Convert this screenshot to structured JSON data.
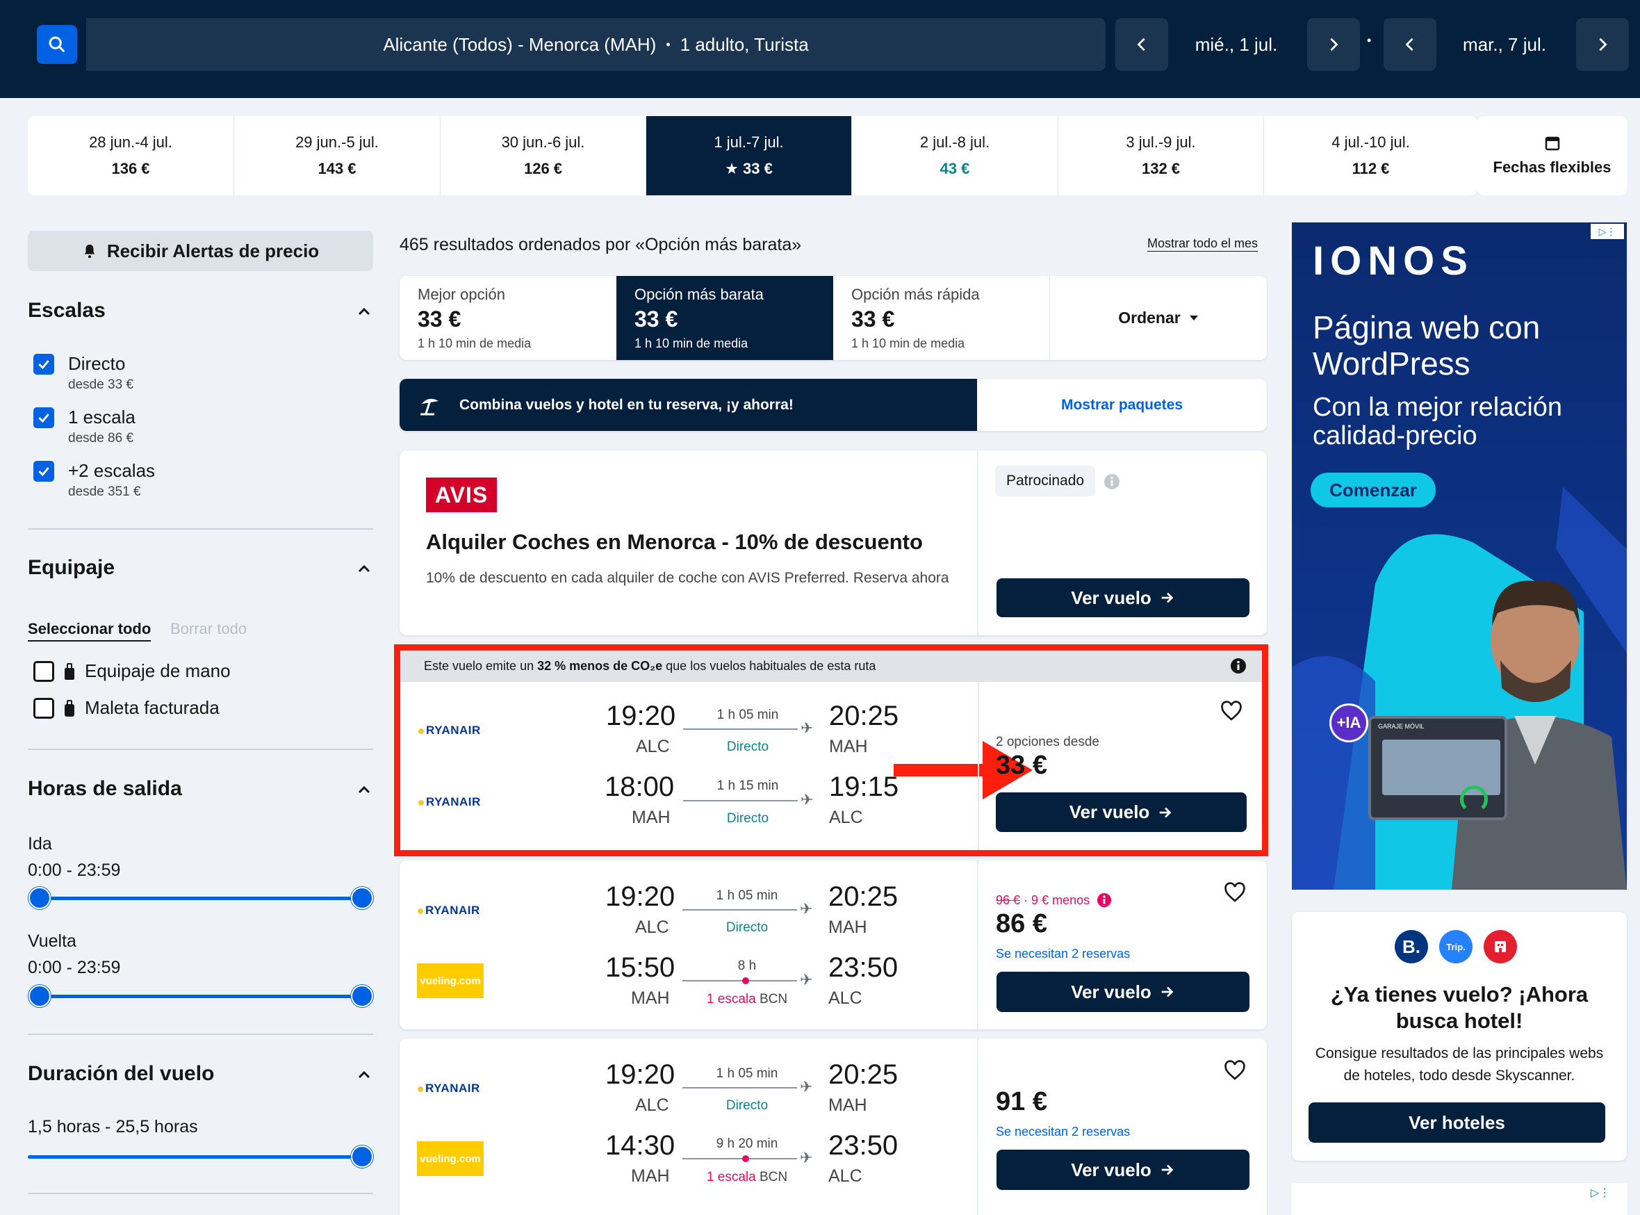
{
  "header": {
    "route": "Alicante (Todos) - Menorca (MAH)",
    "separator": "•",
    "passengers": "1 adulto, Turista",
    "depart_date": "mié., 1 jul.",
    "return_date": "mar., 7 jul.",
    "date_separator": "•"
  },
  "date_strip": [
    {
      "dates": "28 jun.-4 jul.",
      "price": "136 €"
    },
    {
      "dates": "29 jun.-5 jul.",
      "price": "143 €"
    },
    {
      "dates": "30 jun.-6 jul.",
      "price": "126 €"
    },
    {
      "dates": "1 jul.-7 jul.",
      "price": "★ 33 €"
    },
    {
      "dates": "2 jul.-8 jul.",
      "price": "43 €"
    },
    {
      "dates": "3 jul.-9 jul.",
      "price": "132 €"
    },
    {
      "dates": "4 jul.-10 jul.",
      "price": "112 €"
    }
  ],
  "flexible_dates_label": "Fechas flexibles",
  "sidebar": {
    "price_alert": "Recibir Alertas de precio",
    "stops": {
      "title": "Escalas",
      "items": [
        {
          "label": "Directo",
          "sub": "desde 33 €"
        },
        {
          "label": "1 escala",
          "sub": "desde 86 €"
        },
        {
          "label": "+2 escalas",
          "sub": "desde 351 €"
        }
      ]
    },
    "baggage": {
      "title": "Equipaje",
      "select_all": "Seleccionar todo",
      "clear_all": "Borrar todo",
      "items": [
        {
          "label": "Equipaje de mano"
        },
        {
          "label": "Maleta facturada"
        }
      ]
    },
    "departure_times": {
      "title": "Horas de salida",
      "outbound_label": "Ida",
      "outbound_range": "0:00 - 23:59",
      "return_label": "Vuelta",
      "return_range": "0:00 - 23:59"
    },
    "duration": {
      "title": "Duración del vuelo",
      "range": "1,5 horas - 25,5 horas"
    }
  },
  "results": {
    "summary": "465 resultados ordenados por «Opción más barata»",
    "show_month": "Mostrar todo el mes",
    "sort_tabs": [
      {
        "label": "Mejor opción",
        "price": "33 €",
        "sub": "1 h 10 min de media"
      },
      {
        "label": "Opción más barata",
        "price": "33 €",
        "sub": "1 h 10 min de media"
      },
      {
        "label": "Opción más rápida",
        "price": "33 €",
        "sub": "1 h 10 min de media"
      }
    ],
    "sort_button": "Ordenar",
    "package_banner": "Combina vuelos y hotel en tu reserva, ¡y ahorra!",
    "package_button": "Mostrar paquetes"
  },
  "ad_card": {
    "logo": "AVIS",
    "title": "Alquiler Coches en Menorca - 10% de descuento",
    "body": "10% de descuento en cada alquiler de coche con AVIS Preferred. Reserva ahora",
    "sponsored": "Patrocinado",
    "button": "Ver vuelo"
  },
  "eco_banner": {
    "pre": "Este vuelo emite un ",
    "bold": "32 % menos de CO₂e",
    "post": " que los vuelos habituales de esta ruta"
  },
  "flights": [
    {
      "legs": [
        {
          "airline": "RYANAIR",
          "dep": "19:20",
          "dep_code": "ALC",
          "dur": "1 h 05 min",
          "stops": "Directo",
          "arr": "20:25",
          "arr_code": "MAH"
        },
        {
          "airline": "RYANAIR",
          "dep": "18:00",
          "dep_code": "MAH",
          "dur": "1 h 15 min",
          "stops": "Directo",
          "arr": "19:15",
          "arr_code": "ALC"
        }
      ],
      "options": "2 opciones desde",
      "price": "33 €",
      "button": "Ver vuelo"
    },
    {
      "legs": [
        {
          "airline": "RYANAIR",
          "dep": "19:20",
          "dep_code": "ALC",
          "dur": "1 h 05 min",
          "stops": "Directo",
          "arr": "20:25",
          "arr_code": "MAH"
        },
        {
          "airline": "vueling.com",
          "dep": "15:50",
          "dep_code": "MAH",
          "dur": "8 h",
          "stops": "1 escala",
          "stop_code": "BCN",
          "arr": "23:50",
          "arr_code": "ALC"
        }
      ],
      "old_price": "96 €",
      "saving": " · 9 € menos",
      "price": "86 €",
      "note": "Se necesitan 2 reservas",
      "button": "Ver vuelo"
    },
    {
      "legs": [
        {
          "airline": "RYANAIR",
          "dep": "19:20",
          "dep_code": "ALC",
          "dur": "1 h 05 min",
          "stops": "Directo",
          "arr": "20:25",
          "arr_code": "MAH"
        },
        {
          "airline": "vueling.com",
          "dep": "14:30",
          "dep_code": "MAH",
          "dur": "9 h 20 min",
          "stops": "1 escala",
          "stop_code": "BCN",
          "arr": "23:50",
          "arr_code": "ALC"
        }
      ],
      "price": "91 €",
      "note": "Se necesitan 2 reservas",
      "button": "Ver vuelo"
    }
  ],
  "side_ad": {
    "brand": "IONOS",
    "headline": "Página web con WordPress",
    "sub": "Con la mejor relación calidad-precio",
    "cta": "Comenzar",
    "ai_badge": "+IA",
    "screen_label": "GARAJE MÓVIL"
  },
  "hotel_card": {
    "title": "¿Ya tienes vuelo? ¡Ahora busca hotel!",
    "body": "Consigue resultados de las principales webs de hoteles, todo desde Skyscanner.",
    "button": "Ver hoteles",
    "logos": [
      "B.",
      "Trip."
    ]
  },
  "colors": {
    "navy": "#05203c",
    "blue": "#0062e3",
    "highlight_red": "#ff1f0f",
    "teal": "#0c838a",
    "stop_red": "#e70866"
  }
}
